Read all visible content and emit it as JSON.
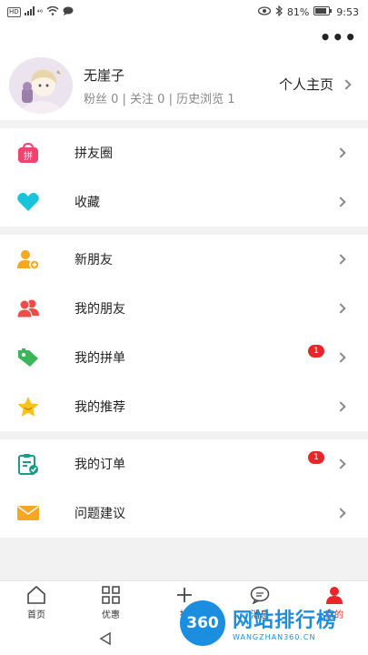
{
  "status_bar": {
    "left_badge": "HD",
    "signal_text": "⁴⁶",
    "battery": "81%",
    "time": "9:53"
  },
  "top_bar": {
    "more_label": "•••"
  },
  "profile": {
    "username": "无崖子",
    "stats": "粉丝 0 | 关注 0 | 历史浏览 1",
    "home_link": "个人主页"
  },
  "groups": [
    {
      "rows": [
        {
          "label": "拼友圈",
          "icon": "shopping-bag-icon",
          "color": "#f2436f"
        },
        {
          "label": "收藏",
          "icon": "heart-icon",
          "color": "#19c3d9"
        }
      ]
    },
    {
      "rows": [
        {
          "label": "新朋友",
          "icon": "add-friend-icon",
          "color": "#f5a623"
        },
        {
          "label": "我的朋友",
          "icon": "friends-icon",
          "color": "#f04a4a"
        },
        {
          "label": "我的拼单",
          "icon": "tag-icon",
          "color": "#3cb55a",
          "badge": "1"
        },
        {
          "label": "我的推荐",
          "icon": "star-icon",
          "color": "#f7c21a"
        }
      ]
    },
    {
      "rows": [
        {
          "label": "我的订单",
          "icon": "clipboard-icon",
          "color": "#1a9b86",
          "badge": "1"
        },
        {
          "label": "问题建议",
          "icon": "mail-icon",
          "color": "#f5a623"
        }
      ]
    }
  ],
  "tab_bar": {
    "tabs": [
      {
        "label": "首页",
        "icon": "home-icon"
      },
      {
        "label": "优惠",
        "icon": "grid-icon"
      },
      {
        "label": "拼",
        "icon": "plus-icon"
      },
      {
        "label": "消息",
        "icon": "chat-icon"
      },
      {
        "label": "我的",
        "icon": "user-icon",
        "active_color": "#e8262a"
      }
    ]
  },
  "watermark": {
    "circle_text": "360",
    "text": "网站排行榜",
    "url": "WANGZHAN360.CN"
  }
}
